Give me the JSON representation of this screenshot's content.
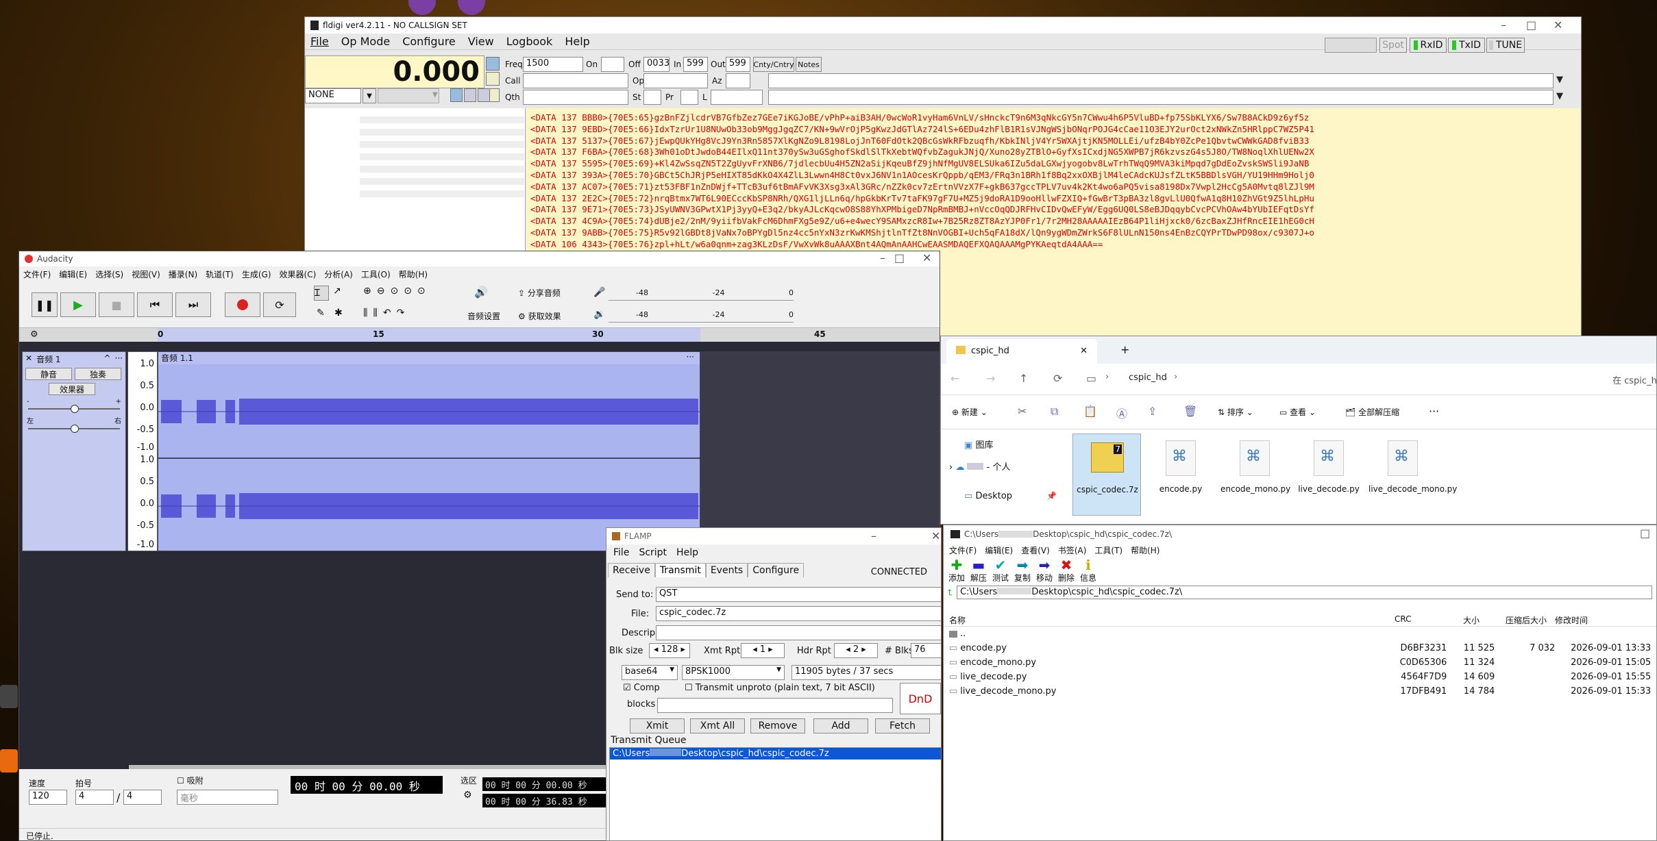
{
  "fldigi": {
    "title": "fldigi ver4.2.11 - NO CALLSIGN SET",
    "menu": [
      "File",
      "Op Mode",
      "Configure",
      "View",
      "Logbook",
      "Help"
    ],
    "top_buttons": [
      "Spot",
      "RxID",
      "TxID",
      "TUNE"
    ],
    "freq_display": "0.000",
    "freq_label": "Freq",
    "freq_value": "1500",
    "on_label": "On",
    "off_label": "Off",
    "off_value": "0033",
    "in_label": "In",
    "in_value": "599",
    "out_label": "Out",
    "out_value": "599",
    "cnty_label": "Cnty/Cntry",
    "notes_label": "Notes",
    "call_label": "Call",
    "op_label": "Op",
    "az_label": "Az",
    "qth_label": "Qth",
    "st_label": "St",
    "pr_label": "Pr",
    "l_label": "L",
    "mode_select": "NONE",
    "rx_lines": [
      "<DATA 137 BBB0>{70E5:65}gzBnFZjlcdrVB7GfbZez7GEe7iKGJoBE/vPhP+aiB3AH/0wcWoR1vyHam6VnLV/sHnckcT9n6M3qNkcGY5n7CWwu4h6P5VluBD+fp75SbKLYX6/Sw7B8ACkD9z6yf5z",
      "<DATA 137 9EBD>{70E5:66}IdxTzrUr1U8NUwOb33ob9MggJgqZC7/KN+9wVrOjP5gKwzJdGTlAz724lS+6EDu4zhFlB1R1sVJNgWSjbONqrPOJG4cCae11O3EJY2urOct2xNWkZn5HRlppC7WZ5P41",
      "<DATA 137 5137>{70E5:67}jEwpQUkYHg8VcJ9Yn3Rn5857XlKgNZo9L8198LojJnT60FdOtk2QBcGsWkRFbzuqfh/KbkINljV4Yr5WXAjtjKN5MOLLEi/ufzB4bY0ZcPe1QbvtwCWWkGAD8fviB33",
      "<DATA 137 F6BA>{70E5:68}3Wh01oDtJwdoB44EIlxQ11nt370ySw3uGSghofSkdlSlTkXebtWQfvbZagukJNjQ/Xuno28yZTBlO+GyfXsICxdjNG5XWPB7jR6kzvszG4s5J8O/TW8NoqlXhlUENw2X",
      "<DATA 137 5595>{70E5:69}+Kl4ZwSsqZN5T2ZgUyvFrXNB6/7jdlecbUu4H5ZN2aSijKqeuBfZ9jhNfMgUV8ELSUka6IZu5daLGXwjyogobv8LwTrhTWqQ9MVA3kiMpqd7gDdEoZvskSWSli9JaNB",
      "<DATA 137 393A>{70E5:70}GBCt5ChJRjP5eHIXT85dKkO4X4ZlL3Lwwn4H8Ct0vxJ6NV1n1AOcesKrQppb/qEM3/FRq3n1BRh1f8Bq2xxOXBjlM4leCAdcKUJsfZLtK5BBDlsVGH/YU19HHm9Holj0",
      "<DATA 137 AC07>{70E5:71}zt53FBF1nZnDWjf+TTcB3uf6tBmAFvVK3Xsg3xAl3GRc/nZZk0cv7zErtnVVzX7F+gkB637gccTPLV7uv4k2Kt4wo6aPQ5visa8198Dx7Vwpl2HcCg5A0Mvtq8lZJl9M",
      "<DATA 137 2E2C>{70E5:72}nrqBtmx7WT6L90ECccKbSP8NRh/QXG1ljLLn6q/hpGkbKrTv7taFK97gF7U+MZ5j9doRA1D9ooHllwFZXIQ+fGwBrT3pBA3zl8gvLlU0QfwA1q8H10ZhVGt9Z5lhLpHu",
      "<DATA 137 9E71>{70E5:73}JSyUWNV3GPwtX1Pj3yyQ+E3q2/bkyAJLcKqcwO8S88YhXPMbigeD7NpRmBMBJ+nVccOqQDJRFHvCIDvQwEFyW/Egg6UQ0LS8eBJDqqybCvcPCVhOAw4bYUbIEFqtDsYf",
      "<DATA 137 4C9A>{70E5:74}dUBje2/2nM/9yiifbVakFcM6DhmFXg5e9Z/u6+e4wecY9SAMxzcR8Iw+7B25Rz8ZT8AzYJP0Fr1/7r2MH28AAAAAIEzB64P1liHjxck0/6zcBaxZJHfRncEIE1hEG0cH",
      "<DATA 137 9ABB>{70E5:75}R5v92lGBDt8jVaNx7oBPYgDl5nz4cc5nYxN3zrKwKMShjtlnTfZt8NnVOGBI+Uch5qFA18dX/lQn9ygWDmZWrkS6F8lULnN150ns4EnBzCQYPrTDwPD98ox/c9307J+o",
      "<DATA 106 4343>{70E5:76}zpl+hLt/w6a0qnm+zag3KLzDsF/VwXvWk8uAAAXBnt4AQmAnAAHCwEAASMDAQEFXQAQAAAMgPYKAeqtdA4AAA=="
    ]
  },
  "audacity": {
    "title": "Audacity",
    "menu": [
      "文件(F)",
      "编辑(E)",
      "选择(S)",
      "视图(V)",
      "播录(N)",
      "轨道(T)",
      "生成(G)",
      "效果器(C)",
      "分析(A)",
      "工具(O)",
      "帮助(H)"
    ],
    "audio_setup": "音频设置",
    "share_audio": "分享音频",
    "get_effects": "获取效果",
    "meter_left": [
      "-48",
      "-24",
      "0"
    ],
    "meter_right": [
      "-48",
      "-24",
      "0"
    ],
    "ruler": [
      "0",
      "15",
      "30",
      "45"
    ],
    "track_name": "音频 1",
    "clip_name": "音频 1.1",
    "mute": "静音",
    "solo": "独奏",
    "effects": "效果器",
    "pan_left": "左",
    "pan_right": "右",
    "gain_minus": "-",
    "gain_plus": "+",
    "y_ticks": [
      "1.0",
      "0.5",
      "0.0",
      "-0.5",
      "-1.0"
    ],
    "rate_label": "速度",
    "rate_value": "120",
    "beats_label": "拍号",
    "beats_a": "4",
    "beats_sep": "/",
    "beats_b": "4",
    "snap_label": "吸附",
    "snap_unit": "毫秒",
    "time_display": "00 时 00 分 00.00 秒",
    "selection_label": "选区",
    "sel_start": "00 时 00 分 00.00 秒",
    "sel_end": "00 时 00 分 36.83 秒",
    "status": "已停止."
  },
  "flamp": {
    "title": "FLAMP",
    "menu": [
      "File",
      "Script",
      "Help"
    ],
    "tabs": [
      "Receive",
      "Transmit",
      "Events",
      "Configure"
    ],
    "active_tab": "Transmit",
    "status": "CONNECTED",
    "send_to_label": "Send to:",
    "send_to": "QST",
    "file_label": "File:",
    "file": "cspic_codec.7z",
    "descrip_label": "Descrip",
    "blk_size_label": "Blk size",
    "blk_size": "128",
    "xmt_rpt_label": "Xmt Rpt",
    "xmt_rpt": "1",
    "hdr_rpt_label": "Hdr Rpt",
    "hdr_rpt": "2",
    "blks_label": "# Blks",
    "blks": "76",
    "encoding": "base64",
    "mode": "8PSK1000",
    "size_info": "11905 bytes / 37 secs",
    "comp_label": "Comp",
    "unproto_label": "Transmit unproto (plain text, 7 bit ASCII)",
    "blocks_label": "blocks",
    "dnd": "DnD",
    "buttons": [
      "Xmit",
      "Xmt All",
      "Remove",
      "Add",
      "Fetch"
    ],
    "queue_label": "Transmit Queue",
    "queue_item_pre": "C:\\Users",
    "queue_item_post": "Desktop\\cspic_hd\\cspic_codec.7z"
  },
  "explorer": {
    "tab_title": "cspic_hd",
    "path": "cspic_hd",
    "search_placeholder": "在 cspic_h",
    "toolbar": {
      "new": "新建",
      "sort": "排序",
      "view": "查看",
      "extract": "全部解压缩",
      "more": "···"
    },
    "nav": [
      {
        "label": "图库"
      },
      {
        "label": "- 个人"
      },
      {
        "label": "Desktop"
      }
    ],
    "files": [
      "cspic_codec.7z",
      "encode.py",
      "encode_mono.py",
      "live_decode.py",
      "live_decode_mono.py"
    ]
  },
  "sevenzip": {
    "title_pre": "C:\\Users",
    "title_post": "Desktop\\cspic_hd\\cspic_codec.7z\\",
    "menu": [
      "文件(F)",
      "编辑(E)",
      "查看(V)",
      "书签(A)",
      "工具(T)",
      "帮助(H)"
    ],
    "tools": [
      "添加",
      "解压",
      "测试",
      "复制",
      "移动",
      "删除",
      "信息"
    ],
    "addr_pre": "C:\\Users",
    "addr_post": "Desktop\\cspic_hd\\cspic_codec.7z\\",
    "columns": [
      "名称",
      "CRC",
      "大小",
      "压缩后大小",
      "修改时间"
    ],
    "parent": "..",
    "rows": [
      {
        "name": "encode.py",
        "crc": "D6BF3231",
        "size": "11 525",
        "packed": "7 032",
        "modified": "2026-09-01 13:33"
      },
      {
        "name": "encode_mono.py",
        "crc": "C0D65306",
        "size": "11 324",
        "packed": "",
        "modified": "2026-09-01 15:05"
      },
      {
        "name": "live_decode.py",
        "crc": "4564F7D9",
        "size": "14 609",
        "packed": "",
        "modified": "2026-09-01 15:55"
      },
      {
        "name": "live_decode_mono.py",
        "crc": "17DFB491",
        "size": "14 784",
        "packed": "",
        "modified": "2026-09-01 15:33"
      }
    ]
  },
  "colors": {
    "rx_bg": "#fff6c8",
    "rx_text": "#e00000",
    "audacity_clip": "#aab4ee",
    "waveform": "#5a5ad8",
    "flamp_select": "#0a58d8"
  }
}
